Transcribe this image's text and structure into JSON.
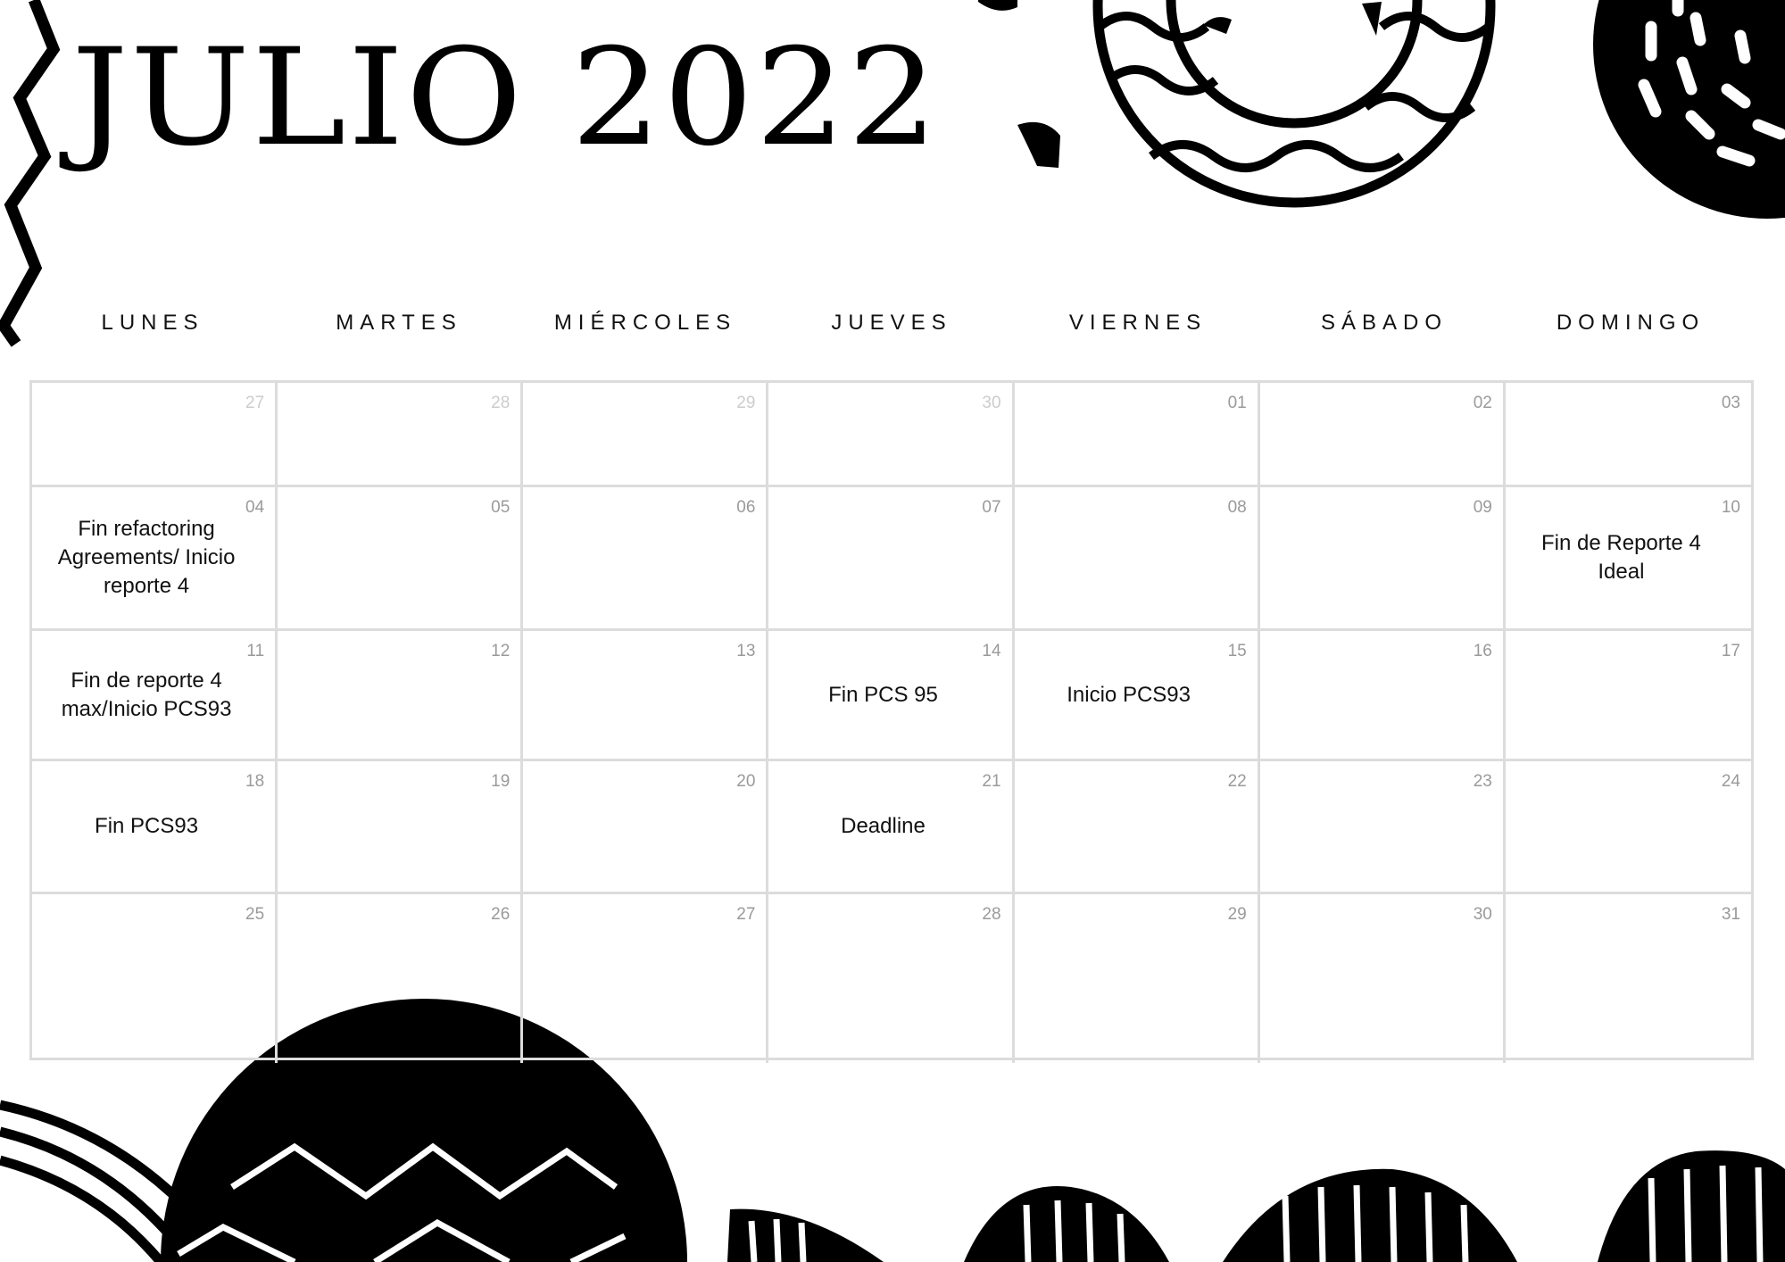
{
  "title": "JULIO 2022",
  "weekdays": [
    "LUNES",
    "MARTES",
    "MIÉRCOLES",
    "JUEVES",
    "VIERNES",
    "SÁBADO",
    "DOMINGO"
  ],
  "weeks": [
    [
      {
        "day": "27",
        "muted": true,
        "note": ""
      },
      {
        "day": "28",
        "muted": true,
        "note": ""
      },
      {
        "day": "29",
        "muted": true,
        "note": ""
      },
      {
        "day": "30",
        "muted": true,
        "note": ""
      },
      {
        "day": "01",
        "muted": false,
        "note": ""
      },
      {
        "day": "02",
        "muted": false,
        "note": ""
      },
      {
        "day": "03",
        "muted": false,
        "note": ""
      }
    ],
    [
      {
        "day": "04",
        "muted": false,
        "note": "Fin refactoring Agreements/ Inicio reporte 4"
      },
      {
        "day": "05",
        "muted": false,
        "note": ""
      },
      {
        "day": "06",
        "muted": false,
        "note": ""
      },
      {
        "day": "07",
        "muted": false,
        "note": ""
      },
      {
        "day": "08",
        "muted": false,
        "note": ""
      },
      {
        "day": "09",
        "muted": false,
        "note": ""
      },
      {
        "day": "10",
        "muted": false,
        "note": "Fin de Reporte 4 Ideal"
      }
    ],
    [
      {
        "day": "11",
        "muted": false,
        "note": "Fin de reporte 4 max/Inicio PCS93"
      },
      {
        "day": "12",
        "muted": false,
        "note": ""
      },
      {
        "day": "13",
        "muted": false,
        "note": ""
      },
      {
        "day": "14",
        "muted": false,
        "note": "Fin PCS 95"
      },
      {
        "day": "15",
        "muted": false,
        "note": "Inicio PCS93"
      },
      {
        "day": "16",
        "muted": false,
        "note": ""
      },
      {
        "day": "17",
        "muted": false,
        "note": ""
      }
    ],
    [
      {
        "day": "18",
        "muted": false,
        "note": "Fin PCS93"
      },
      {
        "day": "19",
        "muted": false,
        "note": ""
      },
      {
        "day": "20",
        "muted": false,
        "note": ""
      },
      {
        "day": "21",
        "muted": false,
        "note": "Deadline"
      },
      {
        "day": "22",
        "muted": false,
        "note": ""
      },
      {
        "day": "23",
        "muted": false,
        "note": ""
      },
      {
        "day": "24",
        "muted": false,
        "note": ""
      }
    ],
    [
      {
        "day": "25",
        "muted": false,
        "note": ""
      },
      {
        "day": "26",
        "muted": false,
        "note": ""
      },
      {
        "day": "27",
        "muted": false,
        "note": ""
      },
      {
        "day": "28",
        "muted": false,
        "note": ""
      },
      {
        "day": "29",
        "muted": false,
        "note": ""
      },
      {
        "day": "30",
        "muted": false,
        "note": ""
      },
      {
        "day": "31",
        "muted": false,
        "note": ""
      }
    ]
  ],
  "colors": {
    "ink": "#000000",
    "grid_line": "#dcdcdc",
    "day_number": "#9a9a9a",
    "day_number_outside_month": "#cccccc"
  }
}
